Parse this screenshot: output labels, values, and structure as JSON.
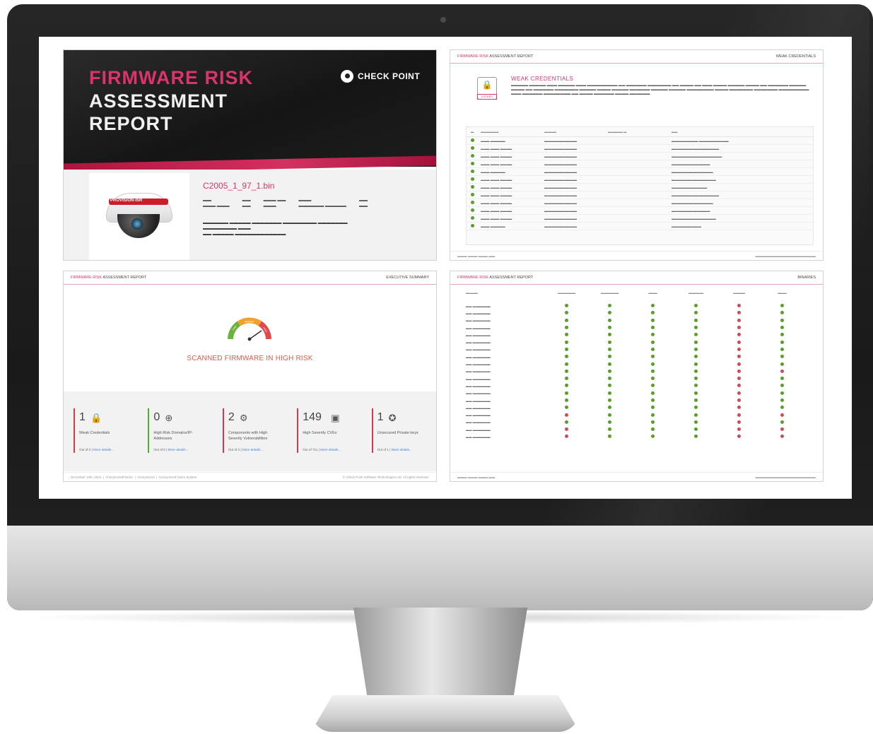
{
  "cover": {
    "title_line1": "FIRMWARE RISK",
    "title_line2": "ASSESSMENT",
    "title_line3": "REPORT",
    "logo_text": "CHECK POINT",
    "firmware_name": "C2005_1_97_1.bin",
    "camera_brand": "PROVISION-ISR"
  },
  "weak_page": {
    "header_left_pink": "FIRMWARE RISK",
    "header_left": "ASSESSMENT REPORT",
    "header_right": "WEAK CREDENTIALS",
    "section_title": "WEAK CREDENTIALS",
    "lock_tag": "LOCKED"
  },
  "exec_page": {
    "header_left_pink": "FIRMWARE RISK",
    "header_left": "ASSESSMENT REPORT",
    "header_right": "EXECUTIVE SUMMARY",
    "gauge_low": "LOW",
    "gauge_medium": "MEDIUM",
    "gauge_high": "HIGH",
    "risk_text": "SCANNED FIRMWARE IN HIGH RISK",
    "stats": [
      {
        "num": "1",
        "label": "Weak Credentials",
        "out": "Out of 2 |",
        "more": "More details...",
        "color": "#d43a4a",
        "icon": "keypad-icon"
      },
      {
        "num": "0",
        "label": "High Risk Domains/IP-Addresses",
        "out": "Out of 0 |",
        "more": "More details...",
        "color": "#4caf2a",
        "icon": "globe-icon"
      },
      {
        "num": "2",
        "label": "Components with High Severity Vulnerabilities",
        "out": "Out of 2 |",
        "more": "More details...",
        "color": "#d43a4a",
        "icon": "components-icon"
      },
      {
        "num": "149",
        "label": "High Severity CVEs",
        "out": "Out of 711 |",
        "more": "More details...",
        "color": "#d43a4a",
        "icon": "cve-icon"
      },
      {
        "num": "1",
        "label": "Unsecured Private keys",
        "out": "Out of 1 |",
        "more": "More details...",
        "color": "#d43a4a",
        "icon": "certificate-icon"
      }
    ],
    "footer_date": "December 14th, 2021",
    "footer_file": "AnonymizedFW.bin",
    "footer_vendor": "Anonymized",
    "footer_device": "Anonymized Alarm System",
    "footer_copy": "© Check Point Software Technologies Ltd. All rights reserved."
  },
  "matrix_page": {
    "header_left_pink": "FIRMWARE RISK",
    "header_left": "ASSESSMENT REPORT",
    "header_right": "BINARIES",
    "rows_status": [
      [
        "g",
        "g",
        "g",
        "g",
        "r",
        "g"
      ],
      [
        "g",
        "g",
        "g",
        "g",
        "r",
        "g"
      ],
      [
        "g",
        "g",
        "g",
        "g",
        "r",
        "g"
      ],
      [
        "g",
        "g",
        "g",
        "g",
        "r",
        "g"
      ],
      [
        "g",
        "g",
        "g",
        "g",
        "r",
        "g"
      ],
      [
        "g",
        "g",
        "g",
        "g",
        "r",
        "g"
      ],
      [
        "g",
        "g",
        "g",
        "g",
        "r",
        "g"
      ],
      [
        "g",
        "g",
        "g",
        "g",
        "r",
        "g"
      ],
      [
        "g",
        "g",
        "g",
        "g",
        "r",
        "g"
      ],
      [
        "g",
        "g",
        "g",
        "g",
        "r",
        "r"
      ],
      [
        "g",
        "g",
        "g",
        "g",
        "r",
        "g"
      ],
      [
        "g",
        "g",
        "g",
        "g",
        "r",
        "g"
      ],
      [
        "g",
        "g",
        "g",
        "g",
        "r",
        "g"
      ],
      [
        "g",
        "g",
        "g",
        "g",
        "r",
        "g"
      ],
      [
        "g",
        "g",
        "g",
        "g",
        "r",
        "g"
      ],
      [
        "r",
        "g",
        "g",
        "g",
        "r",
        "r"
      ],
      [
        "g",
        "g",
        "g",
        "g",
        "r",
        "g"
      ],
      [
        "r",
        "g",
        "g",
        "g",
        "r",
        "r"
      ],
      [
        "r",
        "g",
        "g",
        "g",
        "r",
        "r"
      ]
    ]
  }
}
